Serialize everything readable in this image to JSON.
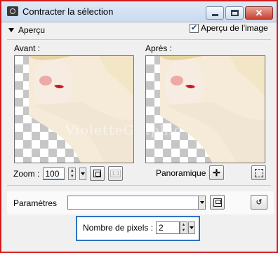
{
  "window": {
    "title": "Contracter la sélection",
    "buttons": {
      "minimize_icon": "minimize-icon",
      "maximize_icon": "maximize-icon",
      "close_icon": "close-icon"
    }
  },
  "preview_section": {
    "toggle_label": "Aperçu",
    "image_preview_label": "Aperçu de l'image",
    "image_preview_checked": true,
    "before_label": "Avant :",
    "after_label": "Après :",
    "watermark": "VioletteGraphic"
  },
  "zoom": {
    "label": "Zoom :",
    "value": "100"
  },
  "pan": {
    "label": "Panoramique :"
  },
  "params": {
    "label": "Paramètres",
    "value": ""
  },
  "pixels": {
    "label": "Nombre de pixels :",
    "value": "2"
  },
  "colors": {
    "window_border": "#d21b1b",
    "group_border": "#2f73c0",
    "checker": "#c6c6c6"
  }
}
